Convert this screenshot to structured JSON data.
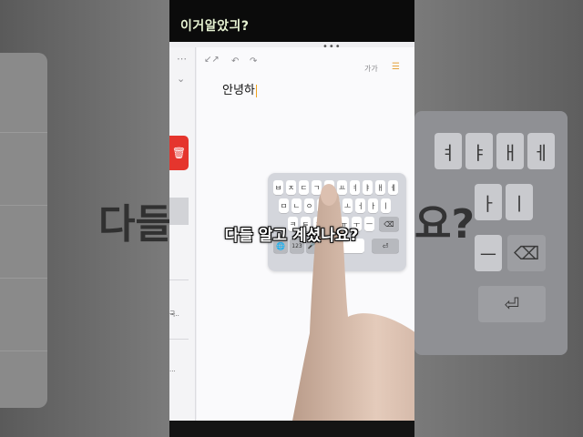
{
  "overlay_title": "이거알았긔?",
  "caption": "다들 알고 계셨나요?",
  "caption_ghost_left": "다들",
  "caption_ghost_right": "요?",
  "note": {
    "text": "안녕하",
    "toolbar": {
      "collapse_icon": "↙↗",
      "undo_icon": "↶",
      "redo_icon": "↷",
      "font_label": "가가",
      "checklist_icon": "☰"
    }
  },
  "sidebar": {
    "more_icon": "⋯",
    "chevron_icon": "⌄",
    "delete_icon": "🗑",
    "snippet_1": "국..",
    "snippet_2": "..."
  },
  "keyboard": {
    "row1": [
      "ㅂ",
      "ㅈ",
      "ㄷ",
      "ㄱ",
      "ㅅ",
      "ㅛ",
      "ㅕ",
      "ㅑ",
      "ㅐ",
      "ㅔ"
    ],
    "row2": [
      "ㅁ",
      "ㄴ",
      "ㅇ",
      "ㄹ",
      "ㅎ",
      "ㅗ",
      "ㅓ",
      "ㅏ",
      "ㅣ"
    ],
    "row3": [
      "ㅋ",
      "ㅌ",
      "ㅊ",
      "ㅍ",
      "ㅠ",
      "ㅜ",
      "ㅡ"
    ],
    "globe": "🌐",
    "numbers": "123",
    "mic": "🎤",
    "backspace": "⌫",
    "return": "⏎"
  },
  "ghost_keyboard": {
    "row1": [
      "ㅕ",
      "ㅑ",
      "ㅐ",
      "ㅔ"
    ],
    "row2": [
      "ㅏ",
      "ㅣ"
    ],
    "row3": [
      "ㅡ"
    ],
    "backspace": "⌫",
    "return": "⏎"
  }
}
